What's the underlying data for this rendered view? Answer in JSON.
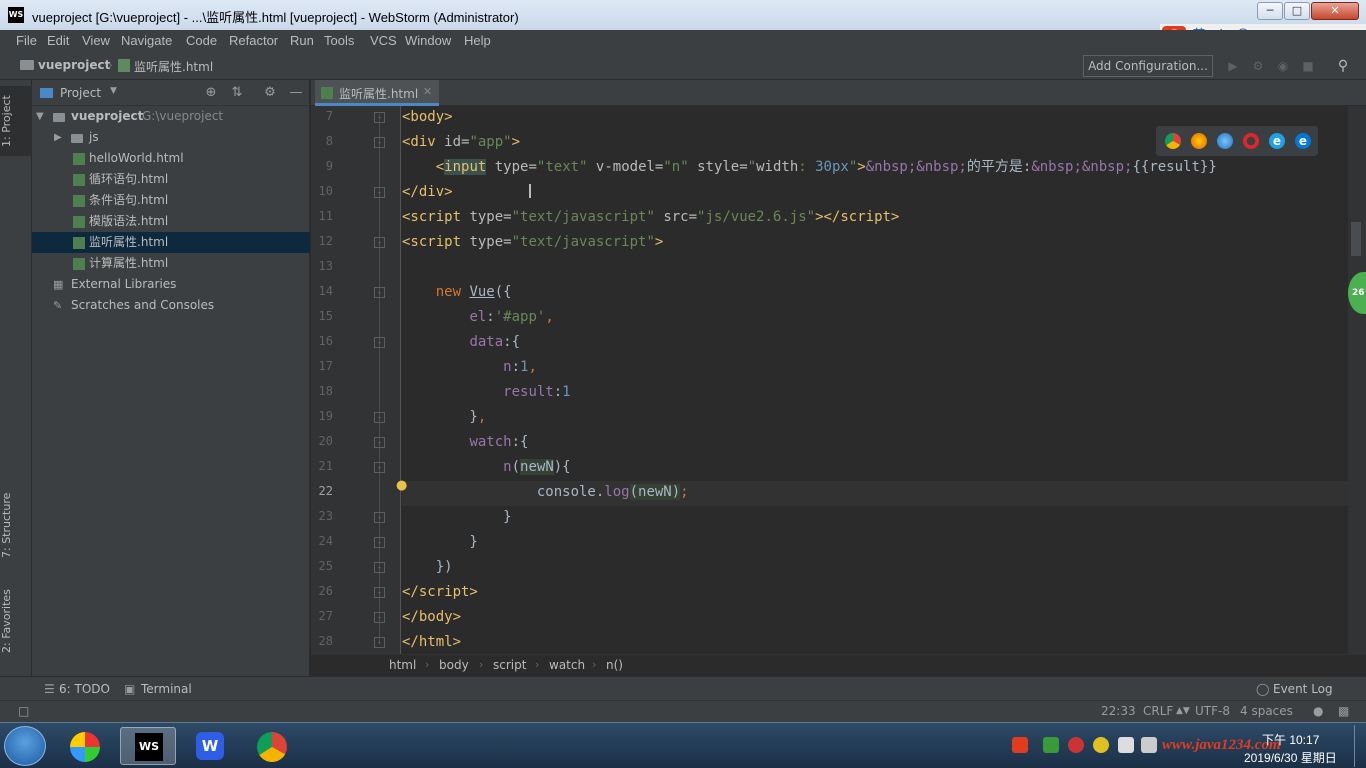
{
  "window": {
    "app_icon": "WS",
    "title": "vueproject [G:\\vueproject] - ...\\监听属性.html [vueproject] - WebStorm (Administrator)",
    "buttons": [
      "minimize",
      "maximize",
      "close"
    ]
  },
  "ime": {
    "logo": "S",
    "lang": "英",
    "icons": [
      "punct-icon",
      "emoji-icon",
      "mic-icon",
      "keyboard-icon",
      "shirt-icon",
      "grid-icon"
    ]
  },
  "menu": [
    "File",
    "Edit",
    "View",
    "Navigate",
    "Code",
    "Refactor",
    "Run",
    "Tools",
    "VCS",
    "Window",
    "Help"
  ],
  "navbar": {
    "project": "vueproject",
    "file": "监听属性.html",
    "add_config": "Add Configuration..."
  },
  "left_tabs": {
    "project": "1: Project",
    "structure": "7: Structure",
    "favorites": "2: Favorites"
  },
  "project_panel": {
    "title": "Project",
    "tree": [
      {
        "label": "vueproject",
        "path": "G:\\vueproject",
        "kind": "root"
      },
      {
        "label": "js",
        "kind": "folder"
      },
      {
        "label": "helloWorld.html",
        "kind": "html"
      },
      {
        "label": "循环语句.html",
        "kind": "html"
      },
      {
        "label": "条件语句.html",
        "kind": "html"
      },
      {
        "label": "模版语法.html",
        "kind": "html"
      },
      {
        "label": "监听属性.html",
        "kind": "html",
        "selected": true
      },
      {
        "label": "计算属性.html",
        "kind": "html"
      },
      {
        "label": "External Libraries",
        "kind": "lib"
      },
      {
        "label": "Scratches and Consoles",
        "kind": "scratch"
      }
    ]
  },
  "editor": {
    "tab": "监听属性.html",
    "line_numbers": [
      "7",
      "8",
      "9",
      "10",
      "11",
      "12",
      "13",
      "14",
      "15",
      "16",
      "17",
      "18",
      "19",
      "20",
      "21",
      "22",
      "23",
      "24",
      "25",
      "26",
      "27",
      "28"
    ],
    "current_line": "22"
  },
  "breadcrumb": [
    "html",
    "body",
    "script",
    "watch",
    "n()"
  ],
  "bottom_tools": {
    "todo": "6: TODO",
    "terminal": "Terminal",
    "event_log": "Event Log"
  },
  "status": {
    "position": "22:33",
    "line_sep": "CRLF",
    "encoding": "UTF-8",
    "indent": "4 spaces"
  },
  "side_badge": "26",
  "taskbar": {
    "time": "下午 10:17",
    "date": "2019/6/30 星期日",
    "watermark": "www.java1234.com"
  }
}
